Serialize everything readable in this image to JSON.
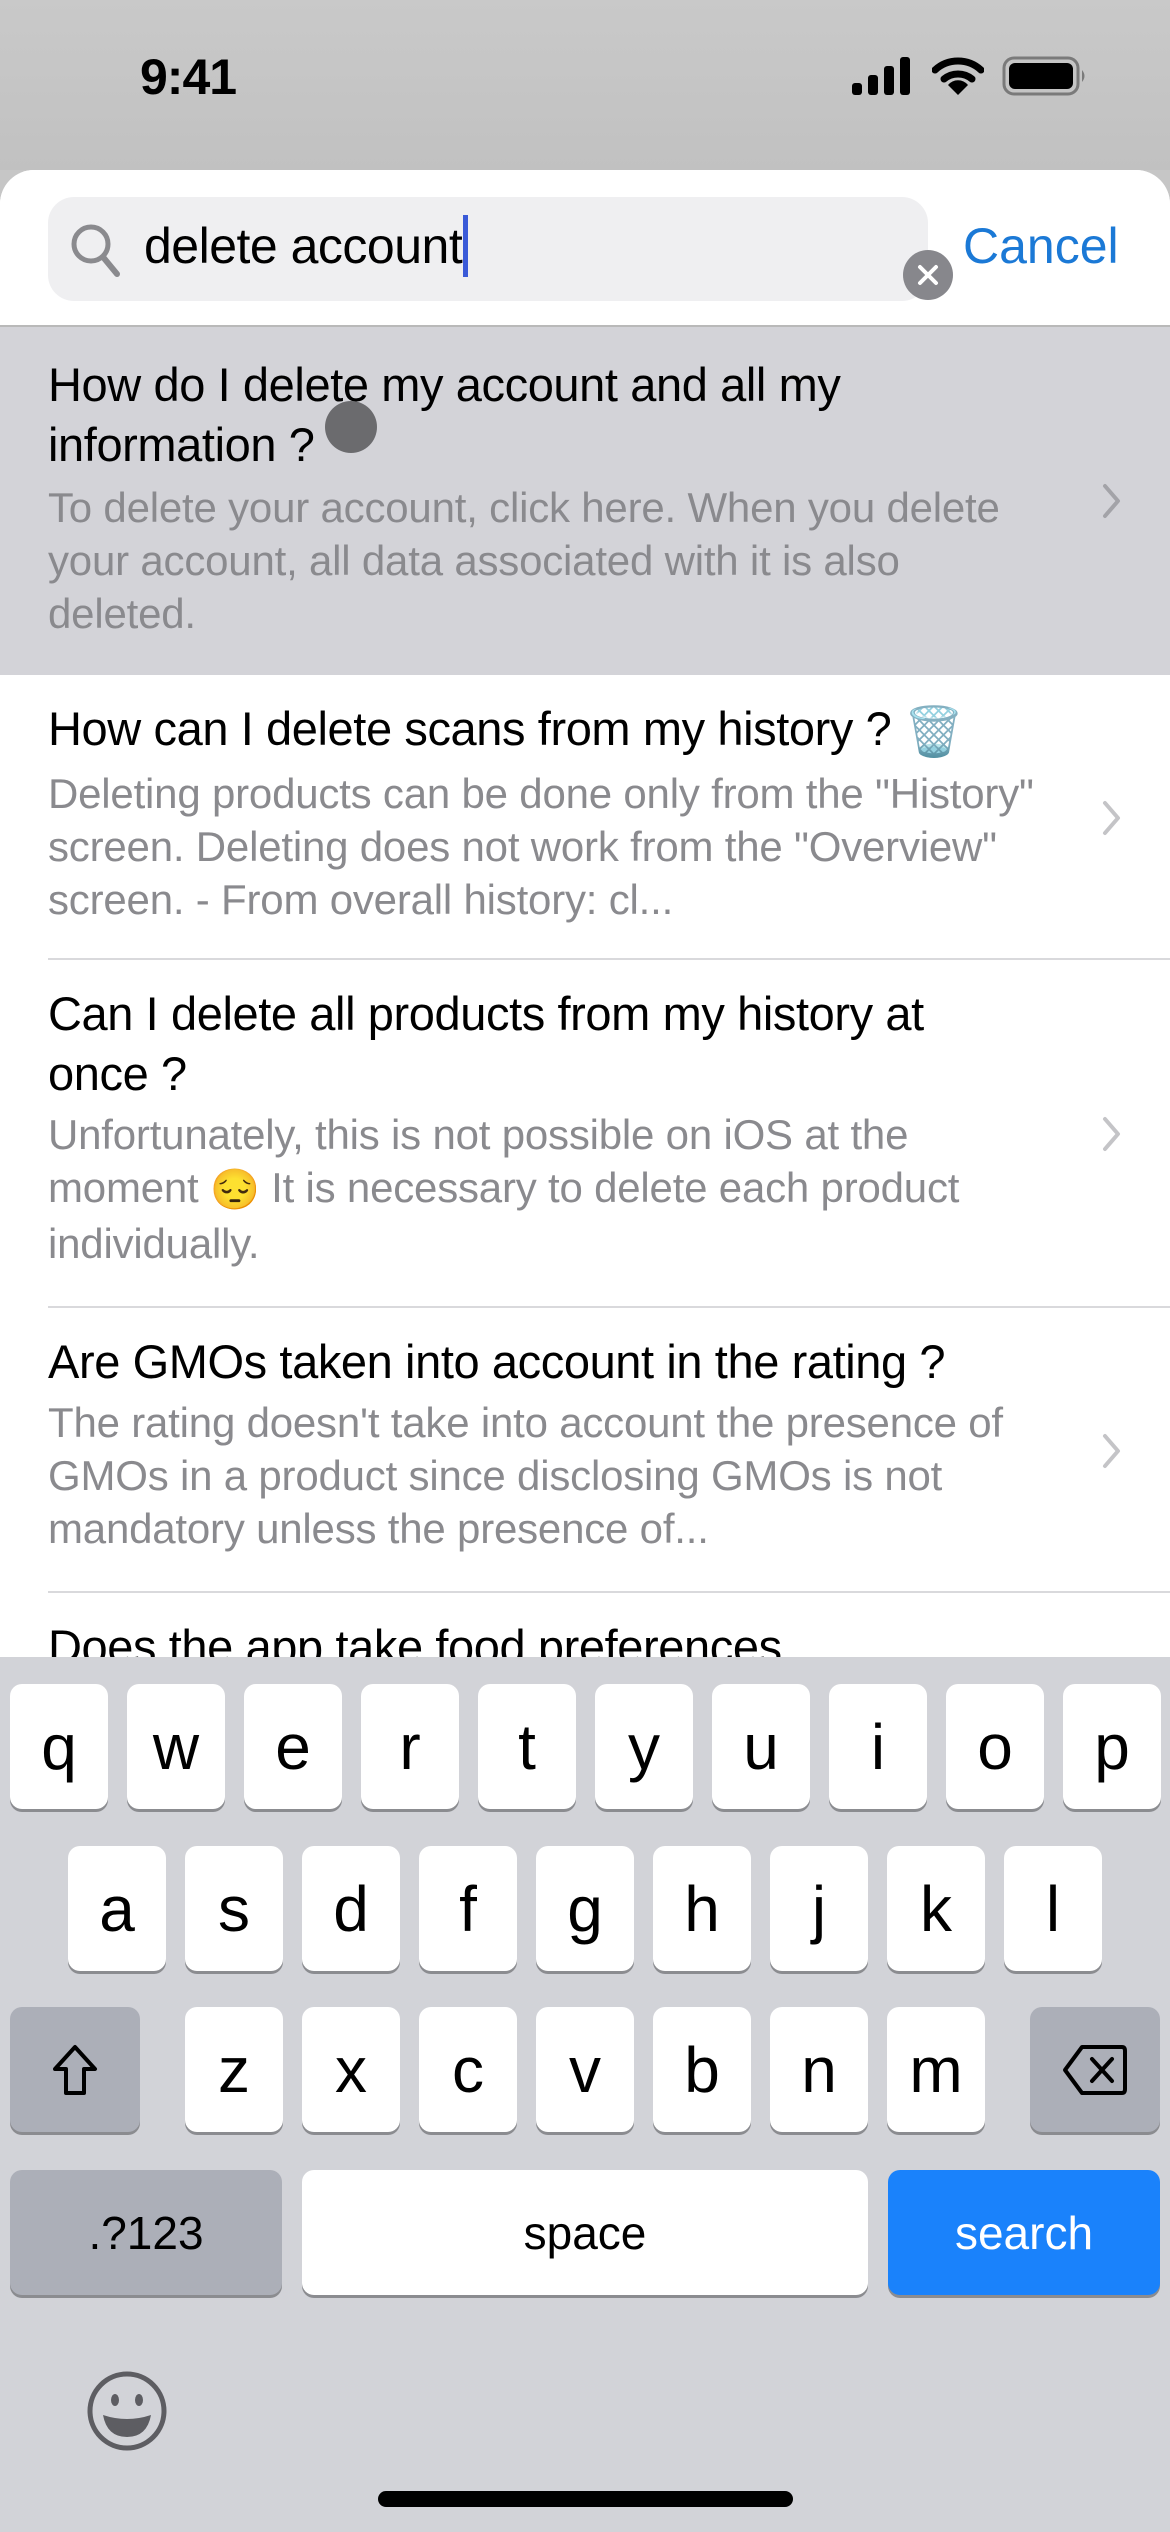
{
  "status_bar": {
    "time": "9:41",
    "icons": [
      "cellular-signal-icon",
      "wifi-icon",
      "battery-icon"
    ]
  },
  "search": {
    "value": "delete account",
    "placeholder": "",
    "clear_icon": "clear-circle-icon",
    "search_icon": "magnifier-icon",
    "cancel_label": "Cancel"
  },
  "colors": {
    "accent": "#1b79d6",
    "keyboard_search": "#1a82fb",
    "highlight_row": "#d3d3d8",
    "secondary_text": "#8a8a8e"
  },
  "faq": {
    "items": [
      {
        "title": "How do I delete my account and all my information ?",
        "answer": "To delete your account, click here. When you delete your account, all data associated with it is also deleted.",
        "highlighted": true
      },
      {
        "title": "How can I delete scans from my history ?",
        "title_emoji": "🗑️",
        "answer": "Deleting products can be done only from the \"History\" screen. Deleting does not work from the \"Overview\" screen. - From overall history: cl..."
      },
      {
        "title": "Can I delete all products from my history at once ?",
        "answer_before_emoji": "Unfortunately, this is not possible on iOS at the moment",
        "answer_emoji": "😔",
        "answer_after_emoji": "It is necessary to delete each product individually."
      },
      {
        "title": "Are GMOs taken into account in the rating ?",
        "answer": "The rating doesn't take into account the presence of GMOs in a product since disclosing GMOs is not mandatory unless the presence of..."
      },
      {
        "title": "Does the app take food preferences"
      }
    ]
  },
  "keyboard": {
    "row1": [
      "q",
      "w",
      "e",
      "r",
      "t",
      "y",
      "u",
      "i",
      "o",
      "p"
    ],
    "row2": [
      "a",
      "s",
      "d",
      "f",
      "g",
      "h",
      "j",
      "k",
      "l"
    ],
    "row3": [
      "z",
      "x",
      "c",
      "v",
      "b",
      "n",
      "m"
    ],
    "shift_icon": "shift-arrow-icon",
    "delete_icon": "backspace-icon",
    "numbers_label": ".?123",
    "space_label": "space",
    "search_label": "search",
    "emoji_icon": "emoji-smiley-icon"
  }
}
